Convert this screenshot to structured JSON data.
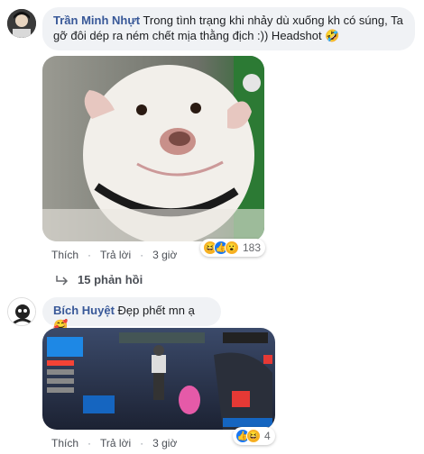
{
  "comments": [
    {
      "author": "Trần Minh Nhựt",
      "text_line1": "Trong tình trạng khi nhảy dù xuống kh có súng, Ta",
      "text_line2": "gỡ đôi dép ra ném chết mịa thằng địch :)) Headshot",
      "emoji": "🤣",
      "action_like": "Thích",
      "action_reply": "Trả lời",
      "time": "3 giờ",
      "reaction_count": "183",
      "reactions": [
        "haha",
        "like",
        "wow"
      ],
      "replies_label": "15 phản hồi"
    },
    {
      "author": "Bích Huyệt",
      "text": "Đẹp phết mn ạ",
      "emoji": "🥰",
      "action_like": "Thích",
      "action_reply": "Trả lời",
      "time": "3 giờ",
      "reaction_count": "4",
      "reactions": [
        "like",
        "haha"
      ]
    }
  ],
  "colors": {
    "author": "#385898",
    "bubble": "#f0f2f5",
    "like": "#1877f2",
    "haha": "#f7b125"
  }
}
